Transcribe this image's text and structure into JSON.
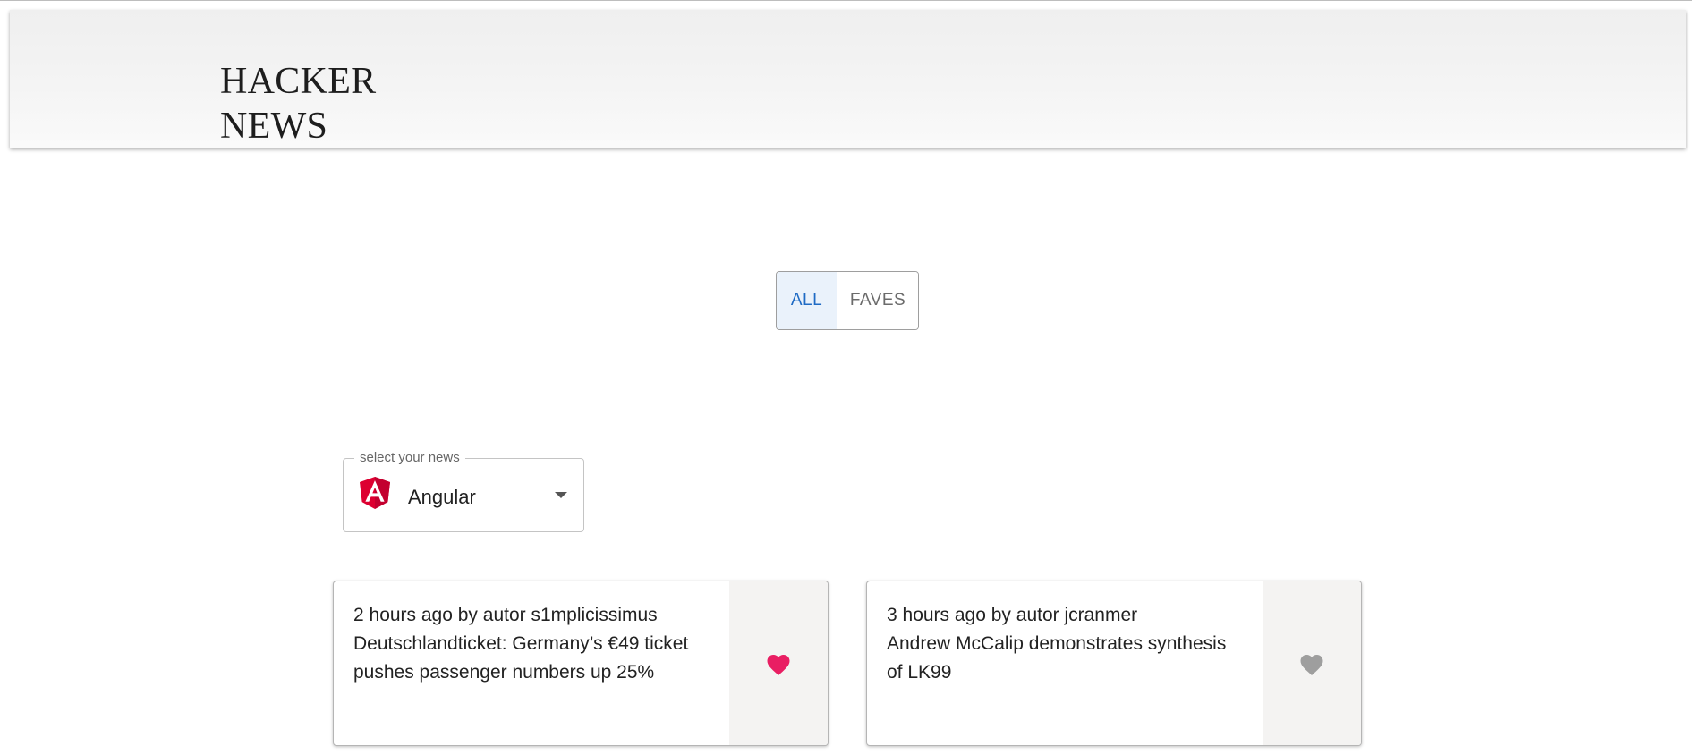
{
  "header": {
    "logo_line1": "HACKER",
    "logo_line2": "NEWS"
  },
  "tabs": [
    {
      "label": "ALL",
      "active": true
    },
    {
      "label": "FAVES",
      "active": false
    }
  ],
  "news_select": {
    "legend": "select your news",
    "selected": "Angular",
    "icon": "angular-icon"
  },
  "colors": {
    "accent_blue": "#1f6bc4",
    "fave_active": "#e91e63",
    "fave_inactive": "#9e9e9e",
    "angular_red": "#dd0031"
  },
  "posts": [
    {
      "meta": "2 hours ago by autor s1mplicissimus",
      "title": "Deutschlandticket: Germany’s €49 ticket pushes passenger numbers up 25%",
      "fave": true
    },
    {
      "meta": "3 hours ago by autor jcranmer",
      "title": "Andrew McCalip demonstrates synthesis of LK99",
      "fave": false
    }
  ]
}
